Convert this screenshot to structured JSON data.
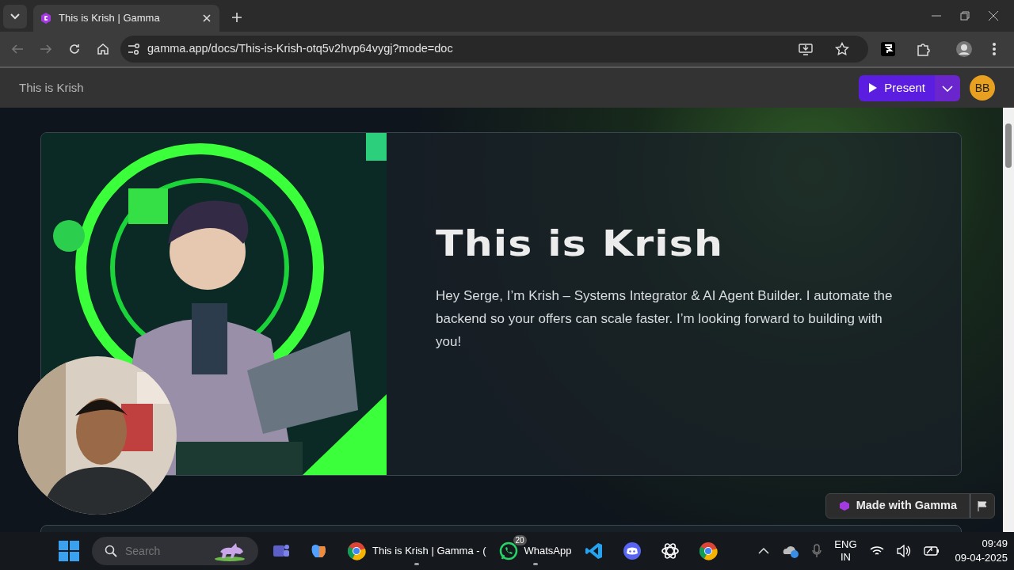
{
  "browser": {
    "tabs": [
      {
        "title": "This is Krish | Gamma",
        "selected": true
      }
    ],
    "url": "gamma.app/docs/This-is-Krish-otq5v2hvp64vygj?mode=doc"
  },
  "app_header": {
    "title": "This is Krish",
    "present_label": "Present",
    "avatar": "BB"
  },
  "card": {
    "heading": "This is Krish",
    "body": " Hey Serge, I’m Krish – Systems Integrator & AI Agent Builder. I automate the backend so your offers can scale faster. I’m looking forward to building with you!"
  },
  "made_with": "Made with Gamma",
  "taskbar": {
    "search_placeholder": "Search",
    "apps": [
      {
        "kind": "teams",
        "running": false
      },
      {
        "kind": "copilot",
        "running": false
      },
      {
        "kind": "chrome",
        "label": "This is Krish | Gamma - (",
        "running": true
      },
      {
        "kind": "whatsapp",
        "label": "WhatsApp",
        "badge": "20",
        "running": true
      },
      {
        "kind": "vscode",
        "running": false
      },
      {
        "kind": "discord",
        "running": false
      },
      {
        "kind": "chatgpt",
        "running": false
      },
      {
        "kind": "chrome",
        "running": false
      }
    ],
    "language": "ENG",
    "region": "IN",
    "time": "09:49",
    "date": "09-04-2025"
  }
}
